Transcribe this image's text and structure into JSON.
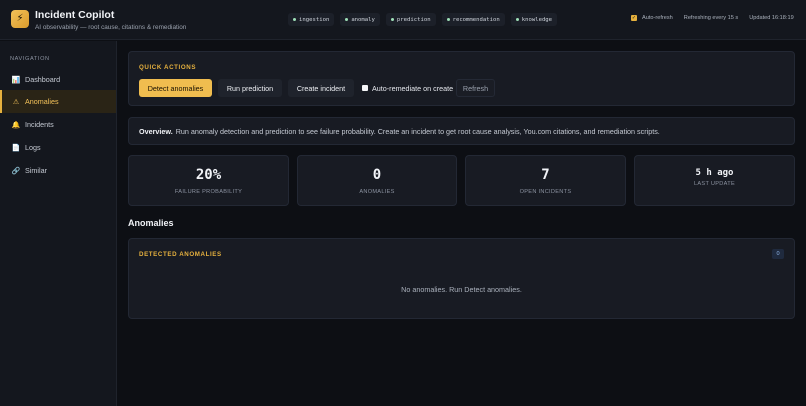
{
  "app": {
    "logo_glyph": "⚡",
    "title": "Incident Copilot",
    "subtitle": "AI observability — root cause, citations & remediation"
  },
  "header": {
    "pills": [
      {
        "label": "ingestion"
      },
      {
        "label": "anomaly"
      },
      {
        "label": "prediction"
      },
      {
        "label": "recommendation"
      },
      {
        "label": "knowledge"
      }
    ],
    "auto_refresh_label": "Auto-refresh",
    "auto_refresh_checked": true,
    "refresh_interval": "Refreshing every 15 s",
    "updated": "Updated 16:18:19"
  },
  "sidebar": {
    "heading": "NAVIGATION",
    "items": [
      {
        "label": "Dashboard",
        "icon": "chart-icon",
        "glyph": "📊",
        "active": false
      },
      {
        "label": "Anomalies",
        "icon": "warning-icon",
        "glyph": "⚠",
        "active": true
      },
      {
        "label": "Incidents",
        "icon": "bell-icon",
        "glyph": "🔔",
        "active": false
      },
      {
        "label": "Logs",
        "icon": "log-icon",
        "glyph": "📄",
        "active": false
      },
      {
        "label": "Similar",
        "icon": "link-icon",
        "glyph": "🔗",
        "active": false
      }
    ]
  },
  "quick_actions": {
    "title": "QUICK ACTIONS",
    "detect": "Detect anomalies",
    "predict": "Run prediction",
    "create": "Create incident",
    "auto_remediate": "Auto-remediate on create",
    "refresh": "Refresh"
  },
  "overview": {
    "label": "Overview.",
    "text": "Run anomaly detection and prediction to see failure probability. Create an incident to get root cause analysis, You.com citations, and remediation scripts."
  },
  "stats": [
    {
      "value": "20%",
      "label": "FAILURE PROBABILITY"
    },
    {
      "value": "0",
      "label": "ANOMALIES"
    },
    {
      "value": "7",
      "label": "OPEN INCIDENTS"
    },
    {
      "value": "5 h ago",
      "label": "LAST UPDATE"
    }
  ],
  "anomalies": {
    "heading": "Anomalies",
    "card_title": "DETECTED ANOMALIES",
    "count": "0",
    "empty_text": "No anomalies. Run Detect anomalies."
  },
  "colors": {
    "accent": "#e6b13e",
    "background": "#0d0f14",
    "panel": "#181b23"
  }
}
